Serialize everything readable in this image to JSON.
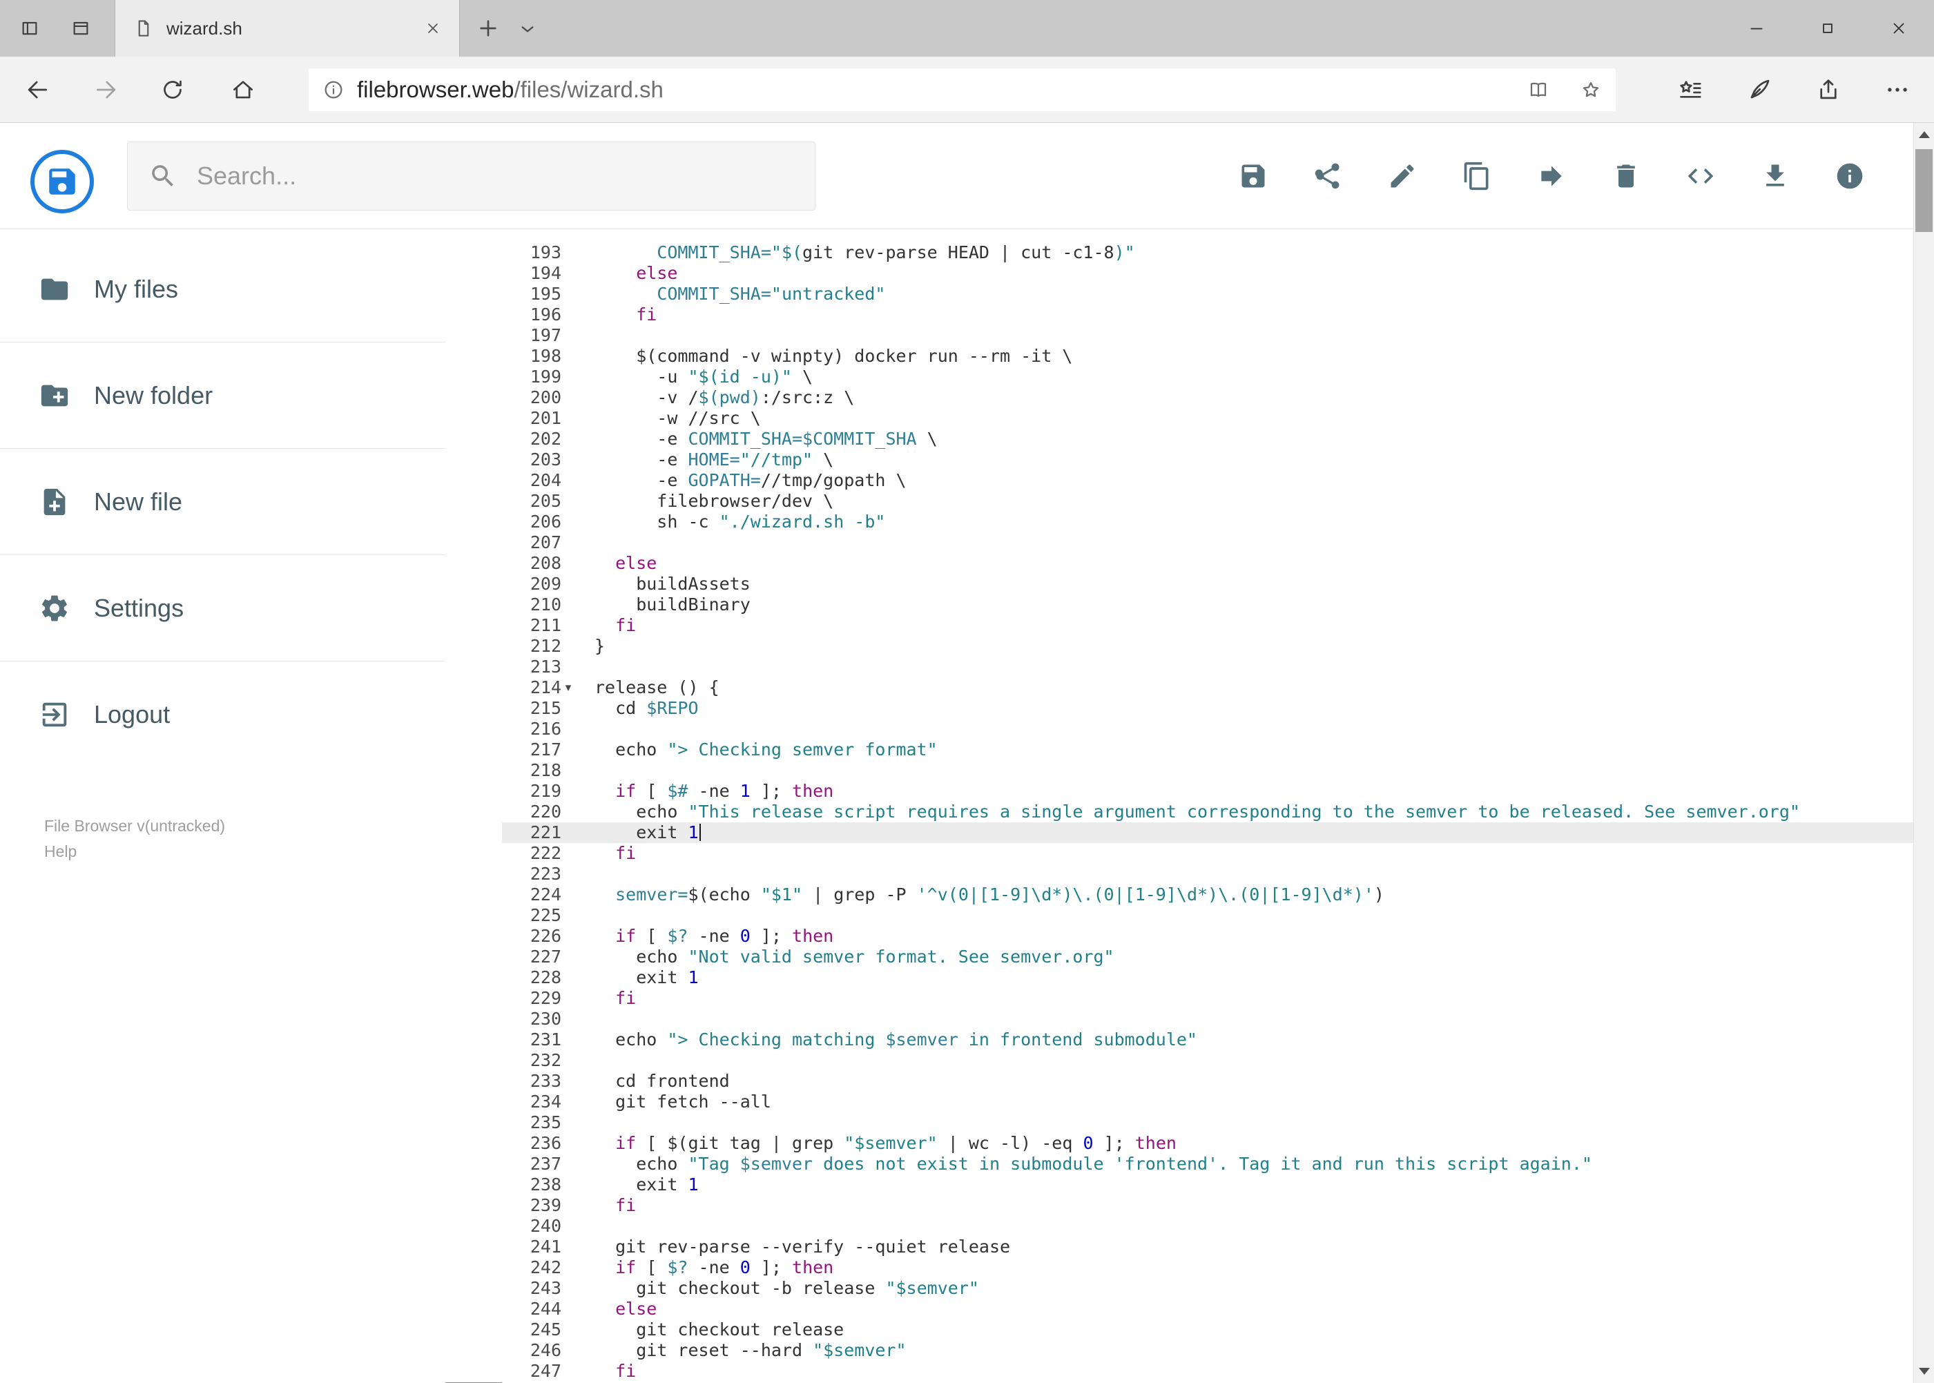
{
  "browser": {
    "tab": {
      "title": "wizard.sh"
    },
    "address": {
      "host": "filebrowser.web",
      "path": "/files/wizard.sh"
    }
  },
  "app": {
    "search_placeholder": "Search...",
    "toolbar": [
      {
        "name": "save-button",
        "icon": "save"
      },
      {
        "name": "share-button",
        "icon": "share-nodes"
      },
      {
        "name": "rename-button",
        "icon": "pencil"
      },
      {
        "name": "copy-button",
        "icon": "copy"
      },
      {
        "name": "move-button",
        "icon": "arrow-forward"
      },
      {
        "name": "delete-button",
        "icon": "trash"
      },
      {
        "name": "source-view-button",
        "icon": "code"
      },
      {
        "name": "download-button",
        "icon": "download"
      },
      {
        "name": "info-button",
        "icon": "info-filled"
      }
    ],
    "sidebar": {
      "items": [
        {
          "name": "sidebar-item-my-files",
          "label": "My files",
          "icon": "folder"
        },
        {
          "name": "sidebar-item-new-folder",
          "label": "New folder",
          "icon": "folder-plus"
        },
        {
          "name": "sidebar-item-new-file",
          "label": "New file",
          "icon": "file-plus"
        },
        {
          "name": "sidebar-item-settings",
          "label": "Settings",
          "icon": "gear"
        },
        {
          "name": "sidebar-item-logout",
          "label": "Logout",
          "icon": "logout"
        }
      ],
      "footer": {
        "version": "File Browser v(untracked)",
        "help": "Help"
      }
    }
  },
  "colors": {
    "accent_blue": "#1d7edd",
    "icon_slate": "#546e7a",
    "keyword": "#96127d",
    "string": "#20808c",
    "variable": "#2e7f95",
    "number": "#0000cd",
    "active_line": "#ececec"
  },
  "editor": {
    "first_line": 193,
    "active_line": 221,
    "fold_line": 214,
    "lines": [
      {
        "n": 193,
        "t": [
          [
            "p",
            "      "
          ],
          [
            "v",
            "COMMIT_SHA="
          ],
          [
            "s",
            "\"$("
          ],
          [
            "p",
            "git rev-parse HEAD | cut -c1-8"
          ],
          [
            "s",
            ")\""
          ]
        ]
      },
      {
        "n": 194,
        "t": [
          [
            "p",
            "    "
          ],
          [
            "k",
            "else"
          ]
        ]
      },
      {
        "n": 195,
        "t": [
          [
            "p",
            "      "
          ],
          [
            "v",
            "COMMIT_SHA="
          ],
          [
            "s",
            "\"untracked\""
          ]
        ]
      },
      {
        "n": 196,
        "t": [
          [
            "p",
            "    "
          ],
          [
            "k",
            "fi"
          ]
        ]
      },
      {
        "n": 197,
        "t": []
      },
      {
        "n": 198,
        "t": [
          [
            "p",
            "    $(command -v winpty) docker run --rm -it \\"
          ]
        ]
      },
      {
        "n": 199,
        "t": [
          [
            "p",
            "      -u "
          ],
          [
            "s",
            "\"$(id -u)\""
          ],
          [
            "p",
            " \\"
          ]
        ]
      },
      {
        "n": 200,
        "t": [
          [
            "p",
            "      -v /"
          ],
          [
            "v",
            "$(pwd)"
          ],
          [
            "p",
            ":/src:z \\"
          ]
        ]
      },
      {
        "n": 201,
        "t": [
          [
            "p",
            "      -w //src \\"
          ]
        ]
      },
      {
        "n": 202,
        "t": [
          [
            "p",
            "      -e "
          ],
          [
            "v",
            "COMMIT_SHA=$COMMIT_SHA"
          ],
          [
            "p",
            " \\"
          ]
        ]
      },
      {
        "n": 203,
        "t": [
          [
            "p",
            "      -e "
          ],
          [
            "v",
            "HOME="
          ],
          [
            "s",
            "\"//tmp\""
          ],
          [
            "p",
            " \\"
          ]
        ]
      },
      {
        "n": 204,
        "t": [
          [
            "p",
            "      -e "
          ],
          [
            "v",
            "GOPATH="
          ],
          [
            "p",
            "//tmp/gopath \\"
          ]
        ]
      },
      {
        "n": 205,
        "t": [
          [
            "p",
            "      filebrowser/dev \\"
          ]
        ]
      },
      {
        "n": 206,
        "t": [
          [
            "p",
            "      sh -c "
          ],
          [
            "s",
            "\"./wizard.sh -b\""
          ]
        ]
      },
      {
        "n": 207,
        "t": []
      },
      {
        "n": 208,
        "t": [
          [
            "p",
            "  "
          ],
          [
            "k",
            "else"
          ]
        ]
      },
      {
        "n": 209,
        "t": [
          [
            "p",
            "    buildAssets"
          ]
        ]
      },
      {
        "n": 210,
        "t": [
          [
            "p",
            "    buildBinary"
          ]
        ]
      },
      {
        "n": 211,
        "t": [
          [
            "p",
            "  "
          ],
          [
            "k",
            "fi"
          ]
        ]
      },
      {
        "n": 212,
        "t": [
          [
            "p",
            "}"
          ]
        ]
      },
      {
        "n": 213,
        "t": []
      },
      {
        "n": 214,
        "t": [
          [
            "p",
            "release () {"
          ]
        ]
      },
      {
        "n": 215,
        "t": [
          [
            "p",
            "  cd "
          ],
          [
            "v",
            "$REPO"
          ]
        ]
      },
      {
        "n": 216,
        "t": []
      },
      {
        "n": 217,
        "t": [
          [
            "p",
            "  echo "
          ],
          [
            "s",
            "\"> Checking semver format\""
          ]
        ]
      },
      {
        "n": 218,
        "t": []
      },
      {
        "n": 219,
        "t": [
          [
            "p",
            "  "
          ],
          [
            "k",
            "if"
          ],
          [
            "p",
            " [ "
          ],
          [
            "v",
            "$#"
          ],
          [
            "p",
            " -ne "
          ],
          [
            "n2",
            "1"
          ],
          [
            "p",
            " ]; "
          ],
          [
            "k",
            "then"
          ]
        ]
      },
      {
        "n": 220,
        "t": [
          [
            "p",
            "    echo "
          ],
          [
            "s",
            "\"This release script requires a single argument corresponding to the semver to be released. See semver.org\""
          ]
        ]
      },
      {
        "n": 221,
        "t": [
          [
            "p",
            "    exit "
          ],
          [
            "n2",
            "1"
          ]
        ]
      },
      {
        "n": 222,
        "t": [
          [
            "p",
            "  "
          ],
          [
            "k",
            "fi"
          ]
        ]
      },
      {
        "n": 223,
        "t": []
      },
      {
        "n": 224,
        "t": [
          [
            "p",
            "  "
          ],
          [
            "v",
            "semver="
          ],
          [
            "p",
            "$(echo "
          ],
          [
            "s",
            "\"$1\""
          ],
          [
            "p",
            " | grep -P "
          ],
          [
            "s",
            "'^v(0|[1-9]\\d*)\\.(0|[1-9]\\d*)\\.(0|[1-9]\\d*)'"
          ],
          [
            "p",
            ")"
          ]
        ]
      },
      {
        "n": 225,
        "t": []
      },
      {
        "n": 226,
        "t": [
          [
            "p",
            "  "
          ],
          [
            "k",
            "if"
          ],
          [
            "p",
            " [ "
          ],
          [
            "v",
            "$?"
          ],
          [
            "p",
            " -ne "
          ],
          [
            "n2",
            "0"
          ],
          [
            "p",
            " ]; "
          ],
          [
            "k",
            "then"
          ]
        ]
      },
      {
        "n": 227,
        "t": [
          [
            "p",
            "    echo "
          ],
          [
            "s",
            "\"Not valid semver format. See semver.org\""
          ]
        ]
      },
      {
        "n": 228,
        "t": [
          [
            "p",
            "    exit "
          ],
          [
            "n2",
            "1"
          ]
        ]
      },
      {
        "n": 229,
        "t": [
          [
            "p",
            "  "
          ],
          [
            "k",
            "fi"
          ]
        ]
      },
      {
        "n": 230,
        "t": []
      },
      {
        "n": 231,
        "t": [
          [
            "p",
            "  echo "
          ],
          [
            "s",
            "\"> Checking matching "
          ],
          [
            "v",
            "$semver"
          ],
          [
            "s",
            " in frontend submodule\""
          ]
        ]
      },
      {
        "n": 232,
        "t": []
      },
      {
        "n": 233,
        "t": [
          [
            "p",
            "  cd frontend"
          ]
        ]
      },
      {
        "n": 234,
        "t": [
          [
            "p",
            "  git fetch --all"
          ]
        ]
      },
      {
        "n": 235,
        "t": []
      },
      {
        "n": 236,
        "t": [
          [
            "p",
            "  "
          ],
          [
            "k",
            "if"
          ],
          [
            "p",
            " [ $(git tag | grep "
          ],
          [
            "s",
            "\"$semver\""
          ],
          [
            "p",
            " | wc -l) -eq "
          ],
          [
            "n2",
            "0"
          ],
          [
            "p",
            " ]; "
          ],
          [
            "k",
            "then"
          ]
        ]
      },
      {
        "n": 237,
        "t": [
          [
            "p",
            "    echo "
          ],
          [
            "s",
            "\"Tag "
          ],
          [
            "v",
            "$semver"
          ],
          [
            "s",
            " does not exist in submodule 'frontend'. Tag it and run this script again.\""
          ]
        ]
      },
      {
        "n": 238,
        "t": [
          [
            "p",
            "    exit "
          ],
          [
            "n2",
            "1"
          ]
        ]
      },
      {
        "n": 239,
        "t": [
          [
            "p",
            "  "
          ],
          [
            "k",
            "fi"
          ]
        ]
      },
      {
        "n": 240,
        "t": []
      },
      {
        "n": 241,
        "t": [
          [
            "p",
            "  git rev-parse --verify --quiet release"
          ]
        ]
      },
      {
        "n": 242,
        "t": [
          [
            "p",
            "  "
          ],
          [
            "k",
            "if"
          ],
          [
            "p",
            " [ "
          ],
          [
            "v",
            "$?"
          ],
          [
            "p",
            " -ne "
          ],
          [
            "n2",
            "0"
          ],
          [
            "p",
            " ]; "
          ],
          [
            "k",
            "then"
          ]
        ]
      },
      {
        "n": 243,
        "t": [
          [
            "p",
            "    git checkout -b release "
          ],
          [
            "s",
            "\"$semver\""
          ]
        ]
      },
      {
        "n": 244,
        "t": [
          [
            "p",
            "  "
          ],
          [
            "k",
            "else"
          ]
        ]
      },
      {
        "n": 245,
        "t": [
          [
            "p",
            "    git checkout release"
          ]
        ]
      },
      {
        "n": 246,
        "t": [
          [
            "p",
            "    git reset --hard "
          ],
          [
            "s",
            "\"$semver\""
          ]
        ]
      },
      {
        "n": 247,
        "t": [
          [
            "p",
            "  "
          ],
          [
            "k",
            "fi"
          ]
        ]
      }
    ]
  }
}
